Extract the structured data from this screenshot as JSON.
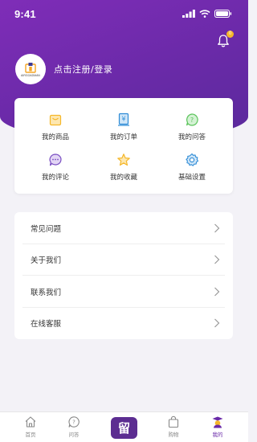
{
  "status_bar": {
    "time": "9:41"
  },
  "profile": {
    "avatar_logo_text": "AIRGOADMAN",
    "login_label": "点击注册/登录"
  },
  "notifications": {
    "badge_count": "0"
  },
  "grid": [
    {
      "label": "我的商品",
      "icon": "shopping-bag-icon",
      "color": "#f5b72a"
    },
    {
      "label": "我的订单",
      "icon": "receipt-icon",
      "color": "#2d8bd6"
    },
    {
      "label": "我的问答",
      "icon": "question-bubble-icon",
      "color": "#5cc45c"
    },
    {
      "label": "我的评论",
      "icon": "comment-icon",
      "color": "#7a4fc2"
    },
    {
      "label": "我的收藏",
      "icon": "star-icon",
      "color": "#f5b72a"
    },
    {
      "label": "基础设置",
      "icon": "gear-icon",
      "color": "#2d8bd6"
    }
  ],
  "menu": [
    {
      "label": "常见问题"
    },
    {
      "label": "关于我们"
    },
    {
      "label": "联系我们"
    },
    {
      "label": "在线客服"
    }
  ],
  "tabbar": {
    "home": "首页",
    "qa": "问答",
    "center": "留",
    "shop": "购物",
    "mine": "我的"
  },
  "colors": {
    "brand": "#6a2aa8",
    "accent": "#f5b72a"
  }
}
